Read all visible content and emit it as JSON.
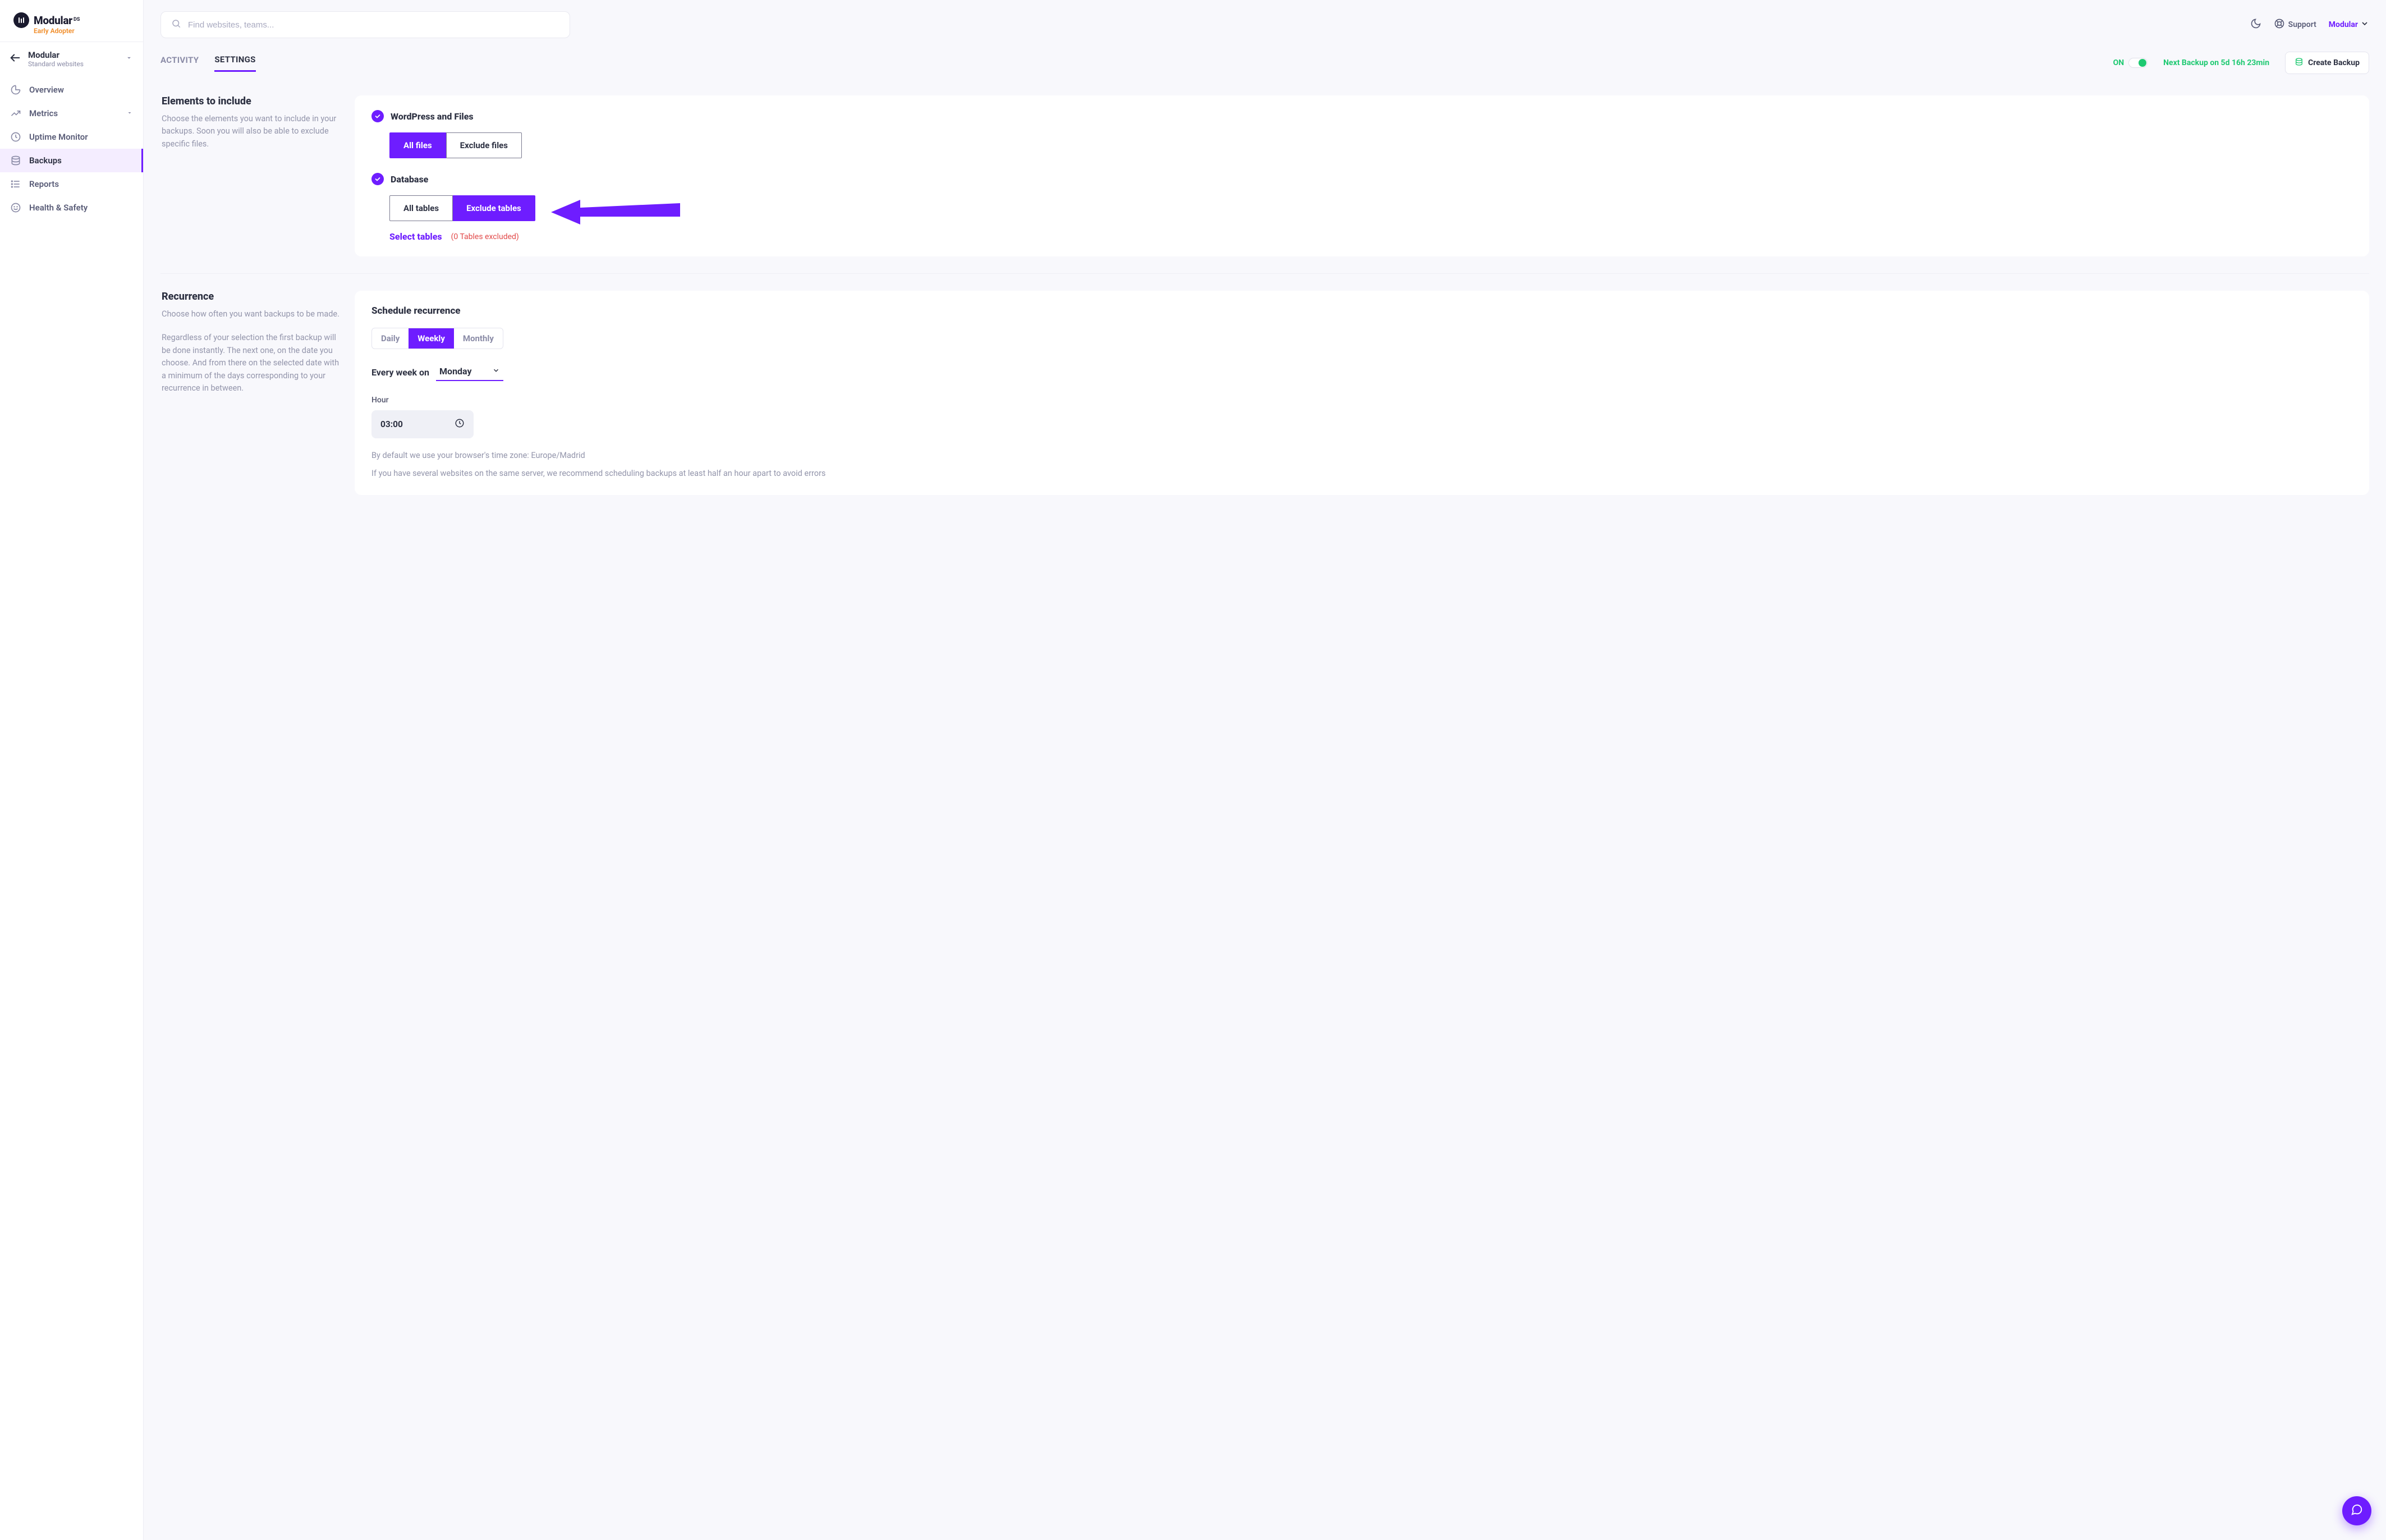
{
  "brand": {
    "name": "Modular",
    "suffix": "DS",
    "tagline": "Early Adopter"
  },
  "context": {
    "name": "Modular",
    "sub": "Standard websites"
  },
  "nav": {
    "overview": "Overview",
    "metrics": "Metrics",
    "uptime": "Uptime Monitor",
    "backups": "Backups",
    "reports": "Reports",
    "health": "Health & Safety"
  },
  "search": {
    "placeholder": "Find websites, teams..."
  },
  "top": {
    "support": "Support",
    "user": "Modular"
  },
  "tabs": {
    "activity": "ACTIVITY",
    "settings": "SETTINGS"
  },
  "status": {
    "on": "ON",
    "next": "Next Backup on 5d 16h 23min",
    "create": "Create Backup"
  },
  "elements": {
    "title": "Elements to include",
    "desc": "Choose the elements you want to include in your backups. Soon you will also be able to exclude specific files.",
    "wp_label": "WordPress and Files",
    "all_files": "All files",
    "exclude_files": "Exclude files",
    "db_label": "Database",
    "all_tables": "All tables",
    "exclude_tables": "Exclude tables",
    "select_tables": "Select tables",
    "excluded_note": "(0 Tables excluded)"
  },
  "recurrence": {
    "title": "Recurrence",
    "desc1": "Choose how often you want backups to be made.",
    "desc2": "Regardless of your selection the first backup will be done instantly. The next one, on the date you choose. And from there on the selected date with a minimum of the days corresponding to your recurrence in between.",
    "schedule_title": "Schedule recurrence",
    "daily": "Daily",
    "weekly": "Weekly",
    "monthly": "Monthly",
    "every_week_on": "Every week on",
    "day": "Monday",
    "hour_label": "Hour",
    "hour_value": "03:00",
    "tz_note": "By default we use your browser's time zone: Europe/Madrid",
    "server_note": "If you have several websites on the same server, we recommend scheduling backups at least half an hour apart to avoid errors"
  }
}
